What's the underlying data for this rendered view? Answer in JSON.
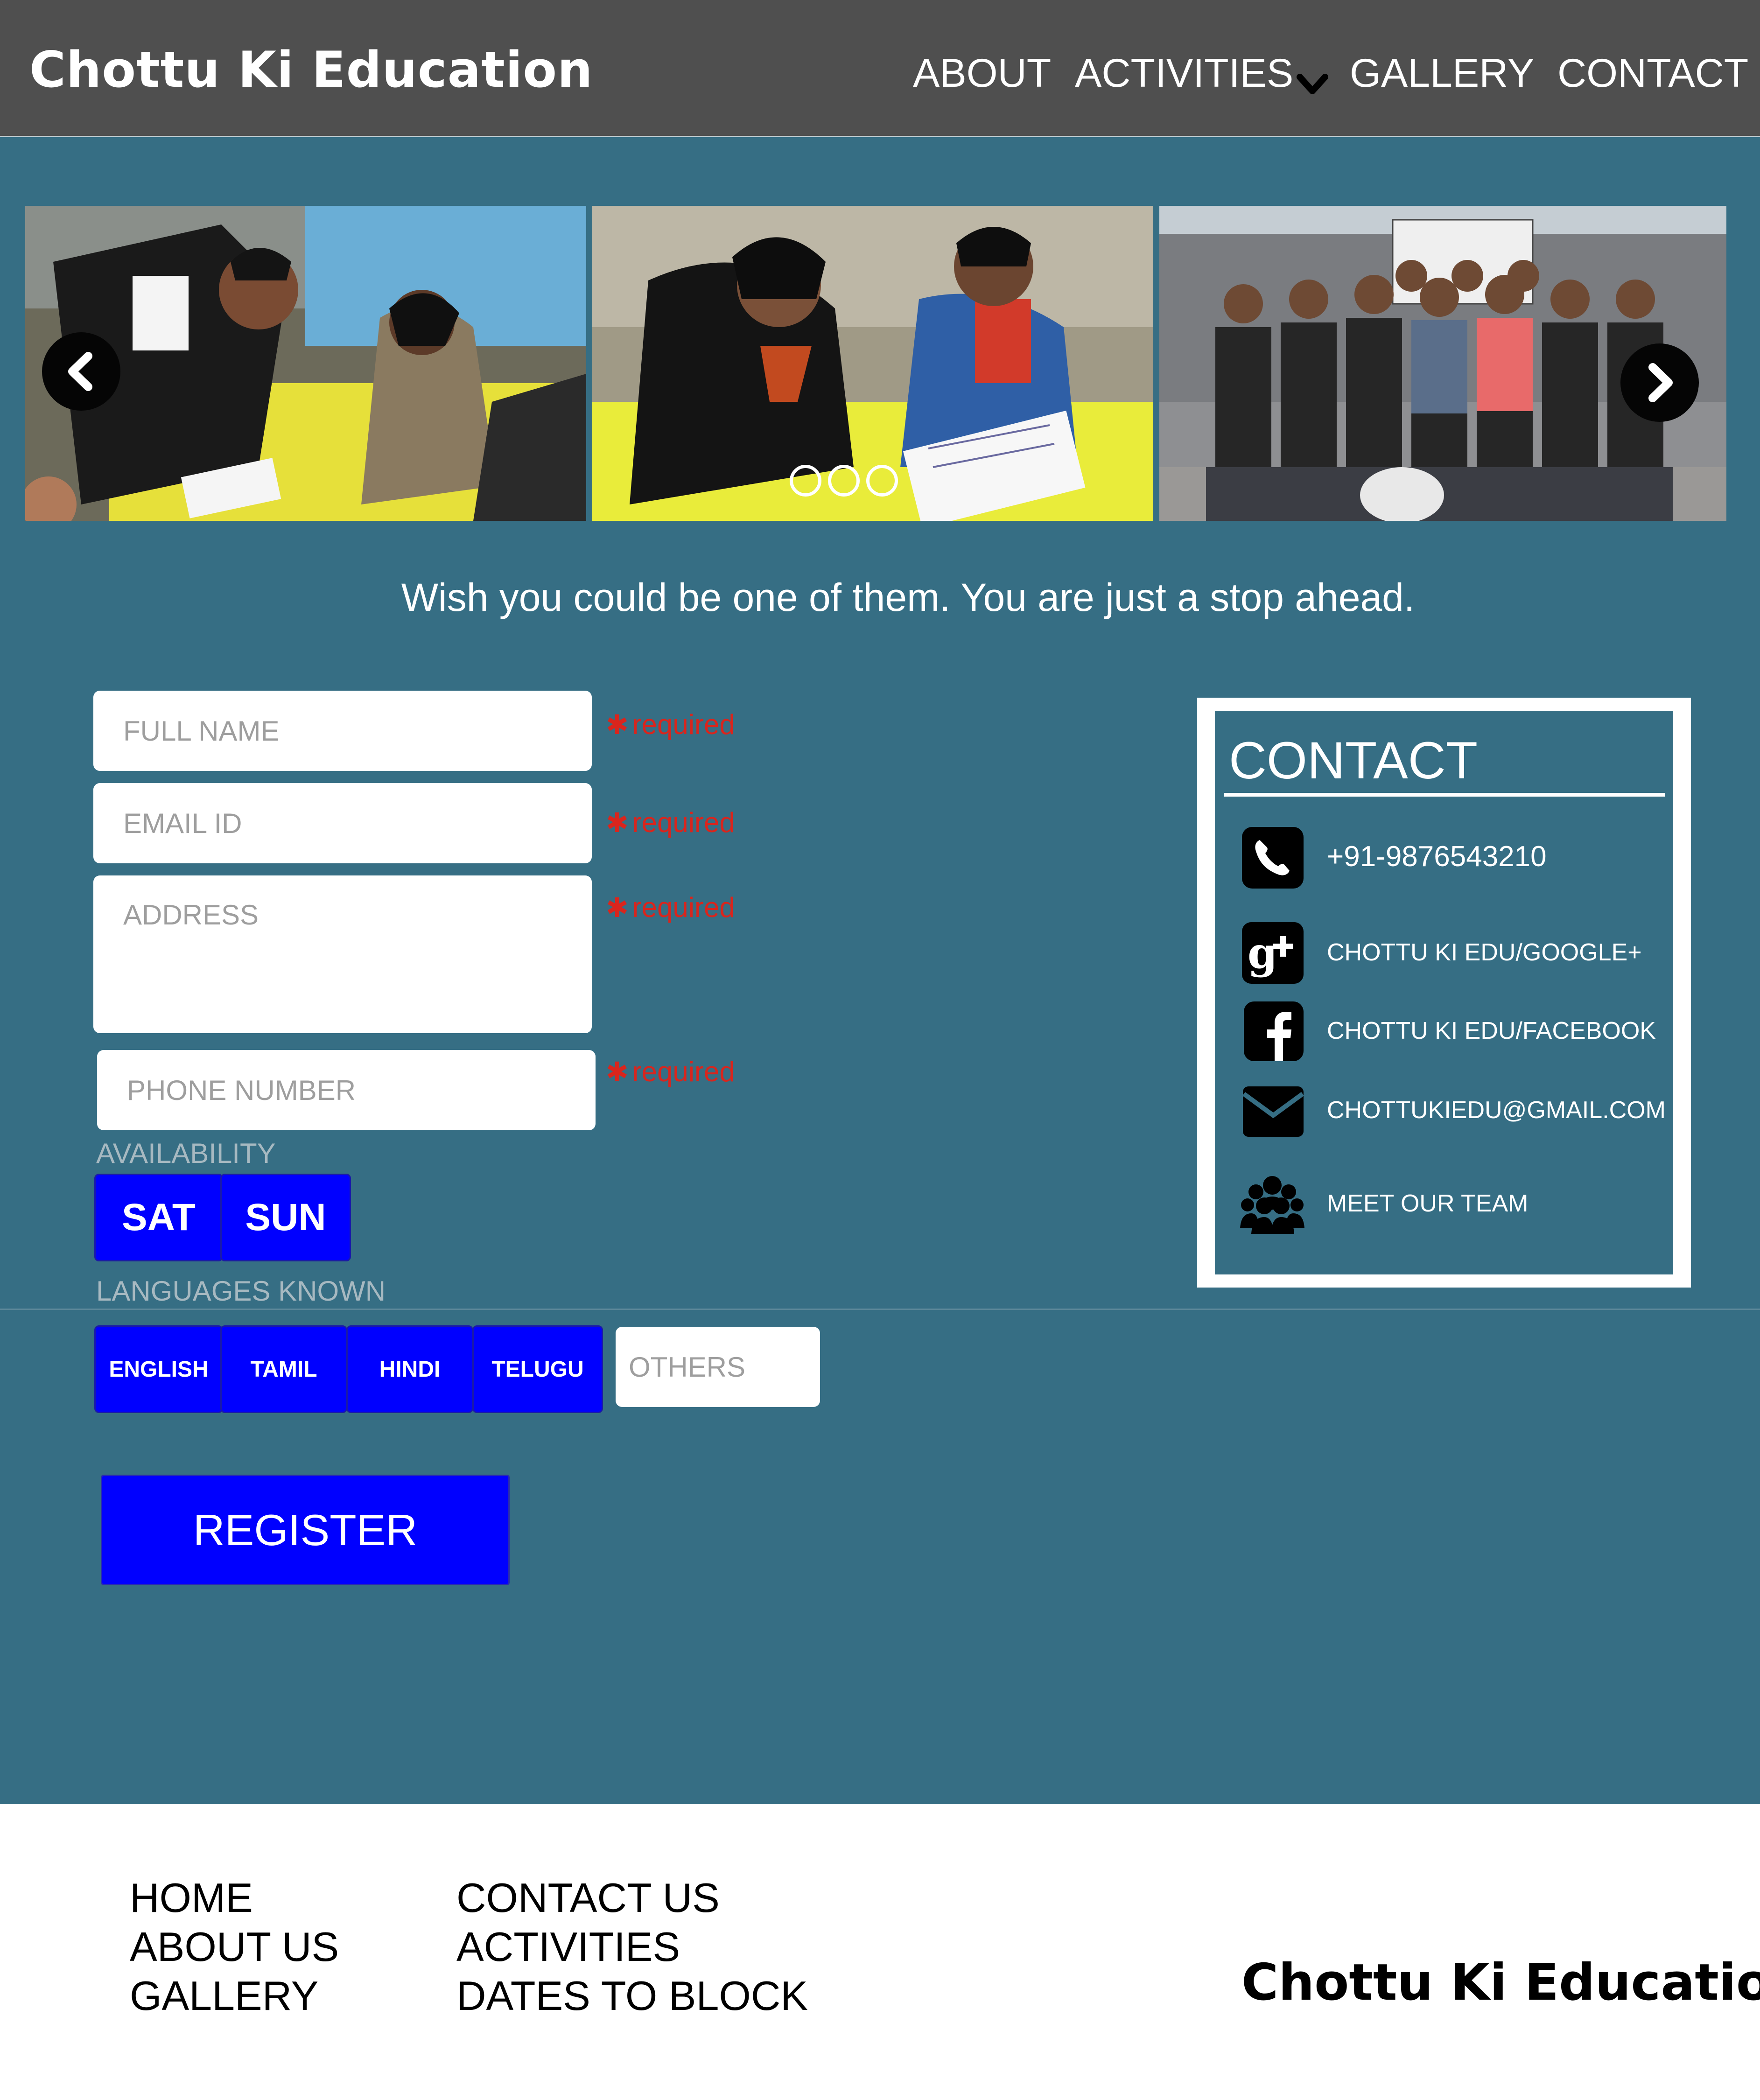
{
  "header": {
    "logo": "Chottu Ki Education",
    "nav": {
      "about": "ABOUT",
      "activities": "ACTIVITIES",
      "gallery": "GALLERY",
      "contact": "CONTACT"
    }
  },
  "carousel": {
    "slides": [
      "volunteer-tutoring-photo",
      "volunteer-teaching-photo",
      "volunteer-group-photo"
    ],
    "prev_icon": "chevron-left-icon",
    "next_icon": "chevron-right-icon",
    "indicator_count": 3
  },
  "tagline": "Wish you could be one of them. You are just a stop ahead.",
  "form": {
    "full_name": {
      "placeholder": "FULL NAME",
      "value": ""
    },
    "email": {
      "placeholder": "EMAIL ID",
      "value": ""
    },
    "address": {
      "placeholder": "ADDRESS",
      "value": ""
    },
    "phone": {
      "placeholder": "PHONE NUMBER",
      "value": ""
    },
    "required_text": "required",
    "required_star": "✱",
    "availability_label": "AVAILABILITY",
    "availability_options": [
      "SAT",
      "SUN"
    ],
    "languages_label": "LANGUAGES KNOWN",
    "language_options": [
      "ENGLISH",
      "TAMIL",
      "HINDI",
      "TELUGU"
    ],
    "others": {
      "placeholder": "OTHERS",
      "value": ""
    },
    "register_label": "REGISTER"
  },
  "contact": {
    "title": "CONTACT",
    "phone": "+91-9876543210",
    "google": "CHOTTU KI EDU/GOOGLE+",
    "facebook": "CHOTTU KI EDU/FACEBOOK",
    "email": "CHOTTUKIEDU@GMAIL.COM",
    "team": "MEET OUR TEAM"
  },
  "footer": {
    "col1": [
      "HOME",
      "ABOUT US",
      "GALLERY"
    ],
    "col2": [
      "CONTACT US",
      "ACTIVITIES",
      "DATES TO BLOCK"
    ],
    "logo": "Chottu Ki Education"
  },
  "colors": {
    "page_bg": "#366e84",
    "header_bg": "#4f4f4f",
    "button_blue": "#0000ff",
    "required_red": "#d9251d",
    "footer_bg": "#ffffff"
  }
}
